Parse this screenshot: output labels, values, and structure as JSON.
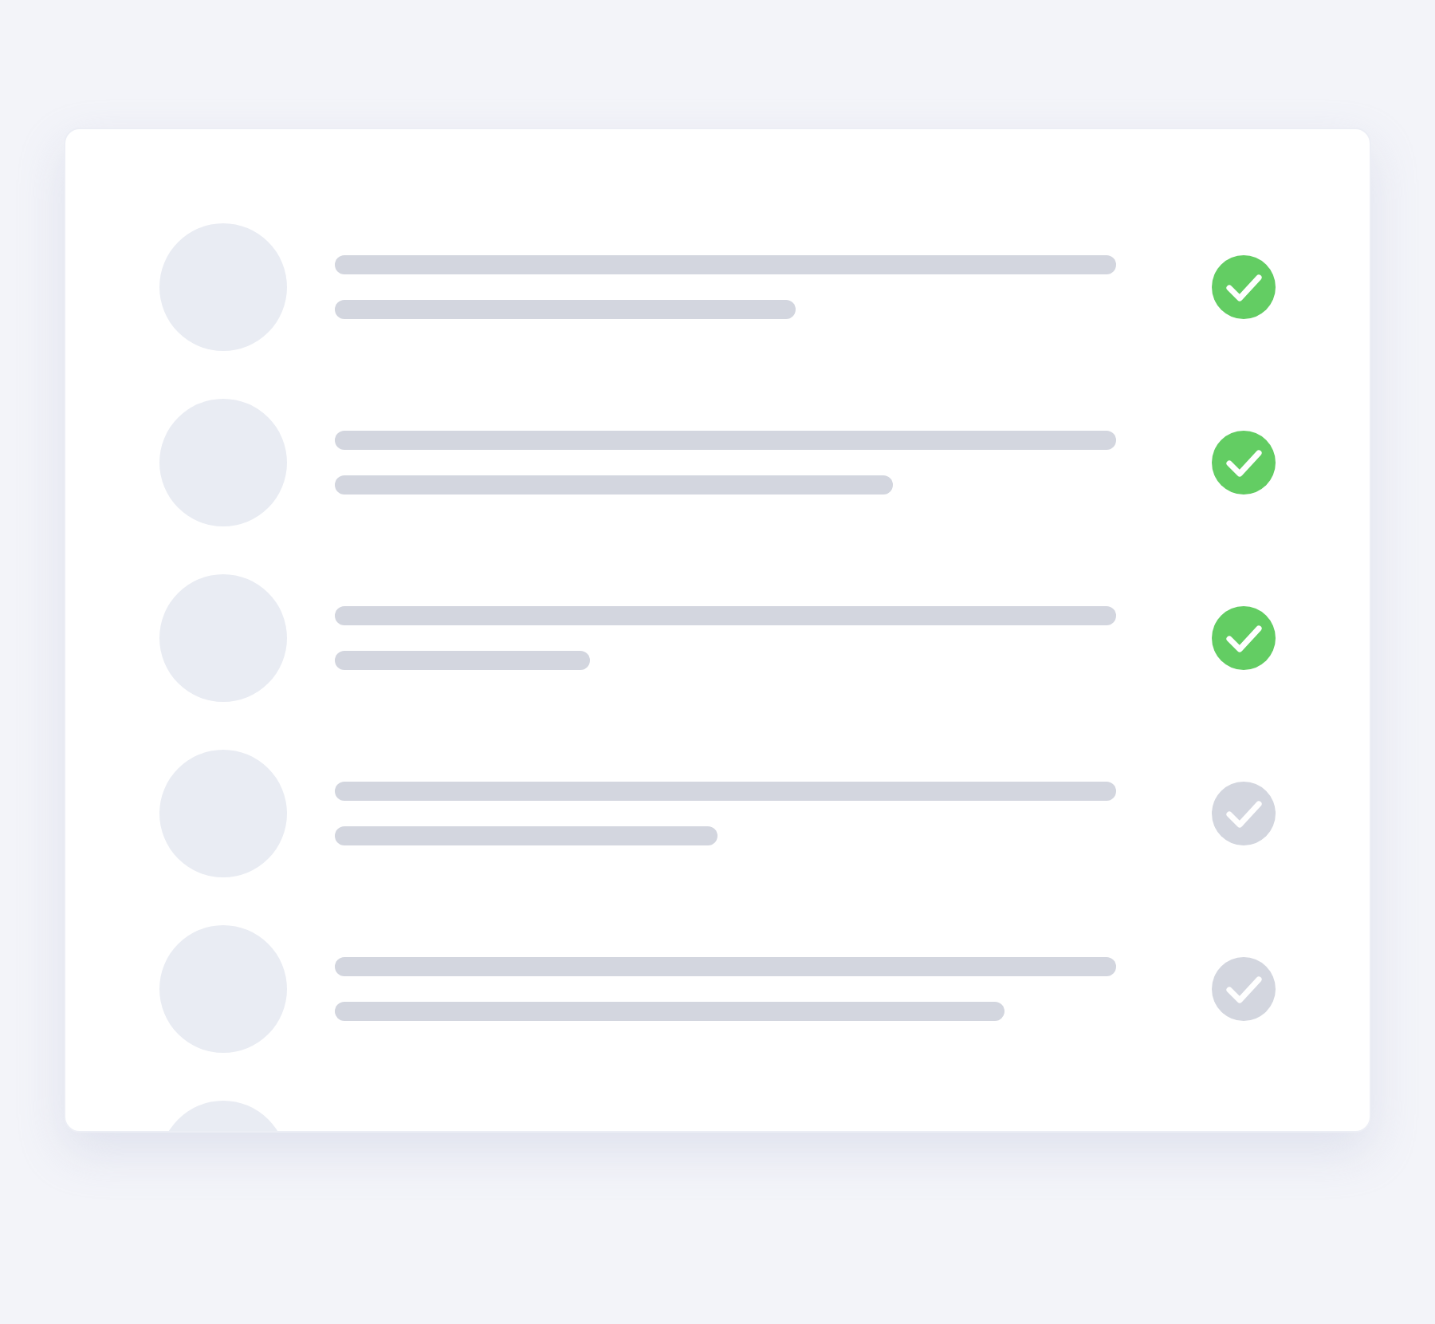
{
  "items": [
    {
      "kind": "full",
      "checked": true
    },
    {
      "kind": "full",
      "checked": true
    },
    {
      "kind": "full",
      "checked": true
    },
    {
      "kind": "full",
      "checked": false
    },
    {
      "kind": "full",
      "checked": false
    },
    {
      "kind": "partial"
    }
  ]
}
